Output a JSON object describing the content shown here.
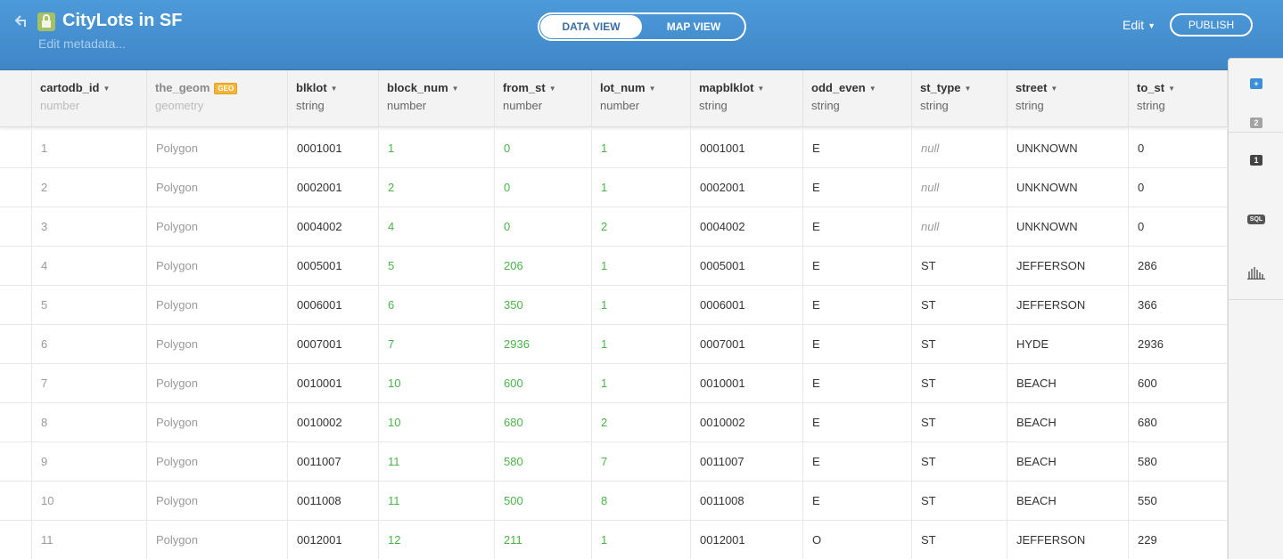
{
  "header": {
    "title": "CityLots in SF",
    "edit_metadata": "Edit metadata...",
    "view_toggle": {
      "data_view": "DATA VIEW",
      "map_view": "MAP VIEW",
      "active": "data_view"
    },
    "edit_menu": "Edit",
    "publish": "PUBLISH"
  },
  "table": {
    "columns": [
      {
        "name": "cartodb_id",
        "type": "number"
      },
      {
        "name": "the_geom",
        "type": "geometry",
        "badge": "GEO"
      },
      {
        "name": "blklot",
        "type": "string"
      },
      {
        "name": "block_num",
        "type": "number"
      },
      {
        "name": "from_st",
        "type": "number"
      },
      {
        "name": "lot_num",
        "type": "number"
      },
      {
        "name": "mapblklot",
        "type": "string"
      },
      {
        "name": "odd_even",
        "type": "string"
      },
      {
        "name": "st_type",
        "type": "string"
      },
      {
        "name": "street",
        "type": "string"
      },
      {
        "name": "to_st",
        "type": "string"
      }
    ],
    "rows": [
      [
        "1",
        "Polygon",
        "0001001",
        "1",
        "0",
        "1",
        "0001001",
        "E",
        "null",
        "UNKNOWN",
        "0"
      ],
      [
        "2",
        "Polygon",
        "0002001",
        "2",
        "0",
        "1",
        "0002001",
        "E",
        "null",
        "UNKNOWN",
        "0"
      ],
      [
        "3",
        "Polygon",
        "0004002",
        "4",
        "0",
        "2",
        "0004002",
        "E",
        "null",
        "UNKNOWN",
        "0"
      ],
      [
        "4",
        "Polygon",
        "0005001",
        "5",
        "206",
        "1",
        "0005001",
        "E",
        "ST",
        "JEFFERSON",
        "286"
      ],
      [
        "5",
        "Polygon",
        "0006001",
        "6",
        "350",
        "1",
        "0006001",
        "E",
        "ST",
        "JEFFERSON",
        "366"
      ],
      [
        "6",
        "Polygon",
        "0007001",
        "7",
        "2936",
        "1",
        "0007001",
        "E",
        "ST",
        "HYDE",
        "2936"
      ],
      [
        "7",
        "Polygon",
        "0010001",
        "10",
        "600",
        "1",
        "0010001",
        "E",
        "ST",
        "BEACH",
        "600"
      ],
      [
        "8",
        "Polygon",
        "0010002",
        "10",
        "680",
        "2",
        "0010002",
        "E",
        "ST",
        "BEACH",
        "680"
      ],
      [
        "9",
        "Polygon",
        "0011007",
        "11",
        "580",
        "7",
        "0011007",
        "E",
        "ST",
        "BEACH",
        "580"
      ],
      [
        "10",
        "Polygon",
        "0011008",
        "11",
        "500",
        "8",
        "0011008",
        "E",
        "ST",
        "BEACH",
        "550"
      ],
      [
        "11",
        "Polygon",
        "0012001",
        "12",
        "211",
        "1",
        "0012001",
        "O",
        "ST",
        "JEFFERSON",
        "229"
      ]
    ]
  },
  "toolbar": {
    "items": [
      {
        "icon": "add-layer-icon",
        "label": "+",
        "color": "#3a8fd6"
      },
      {
        "icon": "layer-2-icon",
        "label": "2",
        "color": "#999999"
      },
      {
        "icon": "layer-1-icon",
        "label": "1",
        "color": "#444444"
      },
      {
        "icon": "sql-icon",
        "label": "SQL"
      },
      {
        "icon": "histogram-icon"
      }
    ]
  },
  "colors": {
    "header": "#4790d2",
    "number_text": "#4cb34a",
    "geo_badge": "#f4b63a"
  }
}
